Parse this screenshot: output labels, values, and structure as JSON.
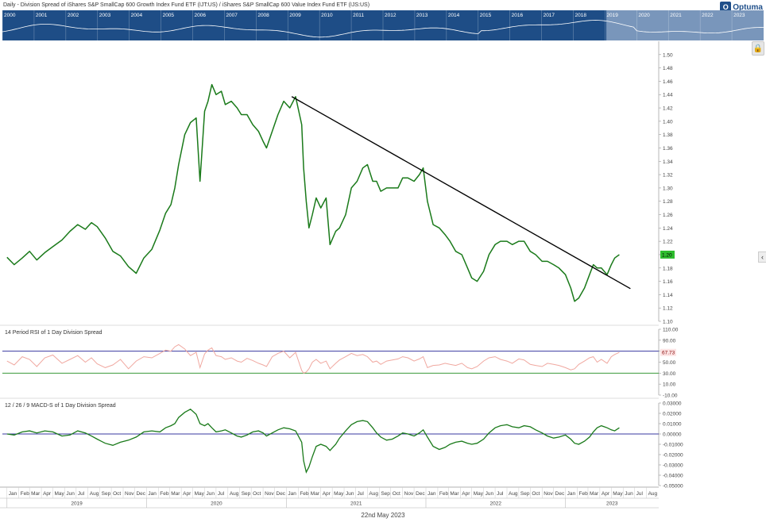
{
  "title": "Daily - Division Spread of iShares S&P SmallCap 600 Growth Index Fund ETF (IJT:US) / iShares S&P SmallCap 600 Value Index Fund ETF (IJS:US)",
  "logo_text": "Optuma",
  "date_caption": "22nd May 2023",
  "overview": {
    "years": [
      "2000",
      "2001",
      "2002",
      "2003",
      "2004",
      "2005",
      "2006",
      "2007",
      "2008",
      "2009",
      "2010",
      "2011",
      "2012",
      "2013",
      "2014",
      "2015",
      "2016",
      "2017",
      "2018",
      "2019",
      "2020",
      "2021",
      "2022",
      "2023"
    ]
  },
  "colors": {
    "price": "#1a7a1a",
    "trendline": "#000000",
    "rsi": "#f0a8a0",
    "rsi_upper": "#3a3aa0",
    "rsi_lower": "#3a9a3a",
    "macd": "#1a7a1a",
    "macd_zero": "#3a3aa0",
    "overview_bg": "#1e4d86",
    "badge_bg": "#2ebd2e"
  },
  "chart_data": [
    {
      "type": "line",
      "name": "price",
      "ylim": [
        1.1,
        1.52
      ],
      "y_ticks": [
        "1.50",
        "1.48",
        "1.46",
        "1.44",
        "1.42",
        "1.40",
        "1.38",
        "1.36",
        "1.34",
        "1.32",
        "1.30",
        "1.28",
        "1.26",
        "1.24",
        "1.22",
        "1.20",
        "1.18",
        "1.16",
        "1.14",
        "1.12",
        "1.10"
      ],
      "last_value_label": "1.20",
      "x": [
        "2019-01-01",
        "2019-01-20",
        "2019-02-10",
        "2019-03-01",
        "2019-03-20",
        "2019-04-10",
        "2019-05-01",
        "2019-05-25",
        "2019-06-15",
        "2019-07-05",
        "2019-07-25",
        "2019-08-10",
        "2019-08-25",
        "2019-09-15",
        "2019-10-05",
        "2019-10-25",
        "2019-11-15",
        "2019-12-05",
        "2019-12-25",
        "2020-01-15",
        "2020-02-05",
        "2020-02-20",
        "2020-03-05",
        "2020-03-15",
        "2020-03-25",
        "2020-04-10",
        "2020-04-25",
        "2020-05-10",
        "2020-05-20",
        "2020-06-01",
        "2020-06-10",
        "2020-06-20",
        "2020-07-01",
        "2020-07-15",
        "2020-07-25",
        "2020-08-10",
        "2020-08-25",
        "2020-09-05",
        "2020-09-20",
        "2020-10-05",
        "2020-10-20",
        "2020-11-01",
        "2020-11-10",
        "2020-11-25",
        "2020-12-10",
        "2020-12-25",
        "2021-01-10",
        "2021-01-25",
        "2021-02-10",
        "2021-02-15",
        "2021-02-22",
        "2021-03-01",
        "2021-03-10",
        "2021-03-20",
        "2021-04-01",
        "2021-04-15",
        "2021-04-25",
        "2021-05-10",
        "2021-05-20",
        "2021-06-05",
        "2021-06-20",
        "2021-07-05",
        "2021-07-20",
        "2021-08-01",
        "2021-08-15",
        "2021-08-25",
        "2021-09-05",
        "2021-09-20",
        "2021-10-05",
        "2021-10-20",
        "2021-11-01",
        "2021-11-15",
        "2021-12-01",
        "2021-12-15",
        "2021-12-25",
        "2022-01-05",
        "2022-01-20",
        "2022-02-05",
        "2022-02-20",
        "2022-03-05",
        "2022-03-20",
        "2022-04-05",
        "2022-04-20",
        "2022-05-01",
        "2022-05-15",
        "2022-06-01",
        "2022-06-15",
        "2022-07-01",
        "2022-07-15",
        "2022-08-01",
        "2022-08-15",
        "2022-09-01",
        "2022-09-15",
        "2022-10-01",
        "2022-10-15",
        "2022-11-01",
        "2022-11-15",
        "2022-12-01",
        "2022-12-15",
        "2023-01-01",
        "2023-01-15",
        "2023-01-25",
        "2023-02-05",
        "2023-02-20",
        "2023-03-05",
        "2023-03-15",
        "2023-03-25",
        "2023-04-05",
        "2023-04-20",
        "2023-05-01",
        "2023-05-10",
        "2023-05-22"
      ],
      "values": [
        1.196,
        1.185,
        1.195,
        1.205,
        1.192,
        1.203,
        1.212,
        1.222,
        1.235,
        1.245,
        1.238,
        1.248,
        1.242,
        1.225,
        1.205,
        1.198,
        1.182,
        1.172,
        1.195,
        1.208,
        1.237,
        1.262,
        1.275,
        1.3,
        1.335,
        1.38,
        1.398,
        1.405,
        1.31,
        1.415,
        1.43,
        1.455,
        1.44,
        1.445,
        1.425,
        1.43,
        1.42,
        1.41,
        1.41,
        1.395,
        1.385,
        1.37,
        1.36,
        1.385,
        1.41,
        1.43,
        1.42,
        1.437,
        1.395,
        1.33,
        1.28,
        1.24,
        1.26,
        1.285,
        1.27,
        1.285,
        1.215,
        1.235,
        1.24,
        1.26,
        1.3,
        1.31,
        1.33,
        1.335,
        1.31,
        1.31,
        1.295,
        1.3,
        1.3,
        1.3,
        1.315,
        1.315,
        1.31,
        1.32,
        1.33,
        1.28,
        1.245,
        1.24,
        1.23,
        1.22,
        1.205,
        1.2,
        1.18,
        1.165,
        1.16,
        1.175,
        1.2,
        1.215,
        1.22,
        1.22,
        1.215,
        1.22,
        1.22,
        1.205,
        1.2,
        1.19,
        1.19,
        1.185,
        1.18,
        1.17,
        1.15,
        1.13,
        1.135,
        1.15,
        1.17,
        1.185,
        1.18,
        1.18,
        1.17,
        1.185,
        1.195,
        1.2
      ],
      "trendline": {
        "x": [
          "2021-01-15",
          "2023-06-20"
        ],
        "values": [
          1.437,
          1.149
        ]
      }
    },
    {
      "type": "line",
      "name": "rsi",
      "label": "14 Period RSI of 1 Day Division Spread",
      "ylim": [
        -10,
        110
      ],
      "y_ticks": [
        "110.00",
        "90.00",
        "70.00",
        "50.00",
        "30.00",
        "10.00",
        "-10.00"
      ],
      "upper_level": 70,
      "lower_level": 30,
      "last_value_label": "67.73",
      "values": [
        52,
        45,
        60,
        55,
        42,
        58,
        63,
        48,
        55,
        62,
        50,
        58,
        47,
        40,
        45,
        55,
        38,
        52,
        60,
        58,
        66,
        72,
        70,
        78,
        82,
        74,
        62,
        68,
        40,
        65,
        72,
        76,
        62,
        60,
        55,
        58,
        52,
        50,
        57,
        53,
        48,
        45,
        42,
        60,
        66,
        70,
        58,
        68,
        35,
        30,
        32,
        38,
        50,
        55,
        48,
        52,
        38,
        48,
        54,
        60,
        66,
        62,
        64,
        60,
        50,
        52,
        46,
        52,
        54,
        56,
        60,
        58,
        52,
        56,
        60,
        40,
        44,
        45,
        48,
        46,
        44,
        48,
        40,
        38,
        42,
        52,
        58,
        60,
        55,
        52,
        48,
        56,
        54,
        46,
        44,
        42,
        48,
        46,
        44,
        40,
        36,
        38,
        46,
        52,
        58,
        60,
        50,
        55,
        48,
        60,
        64,
        67.73
      ]
    },
    {
      "type": "line",
      "name": "macd",
      "label": "12 / 26 / 9 MACD-S of 1 Day Division Spread",
      "ylim": [
        -0.05,
        0.03
      ],
      "y_ticks": [
        "0.03000",
        "0.02000",
        "0.01000",
        "0.00000",
        "-0.01000",
        "-0.02000",
        "-0.03000",
        "-0.04000",
        "-0.05000"
      ],
      "zero_line": 0,
      "values": [
        0.0,
        -0.001,
        0.002,
        0.003,
        0.001,
        0.003,
        0.002,
        -0.002,
        -0.001,
        0.003,
        0.001,
        -0.002,
        -0.005,
        -0.009,
        -0.011,
        -0.008,
        -0.006,
        -0.003,
        0.002,
        0.003,
        0.002,
        0.006,
        0.008,
        0.01,
        0.016,
        0.021,
        0.024,
        0.019,
        0.01,
        0.008,
        0.01,
        0.006,
        0.002,
        0.003,
        0.004,
        0.001,
        -0.002,
        -0.003,
        -0.001,
        0.002,
        0.003,
        0.001,
        -0.002,
        0.001,
        0.004,
        0.006,
        0.005,
        0.003,
        -0.008,
        -0.026,
        -0.037,
        -0.032,
        -0.022,
        -0.012,
        -0.01,
        -0.012,
        -0.016,
        -0.01,
        -0.004,
        0.003,
        0.009,
        0.012,
        0.013,
        0.012,
        0.006,
        0.001,
        -0.003,
        -0.006,
        -0.005,
        -0.002,
        0.001,
        0.0,
        -0.002,
        0.001,
        0.004,
        -0.003,
        -0.012,
        -0.015,
        -0.013,
        -0.01,
        -0.008,
        -0.007,
        -0.009,
        -0.01,
        -0.009,
        -0.005,
        0.001,
        0.006,
        0.008,
        0.009,
        0.007,
        0.006,
        0.008,
        0.007,
        0.004,
        0.001,
        -0.002,
        -0.004,
        -0.003,
        -0.001,
        -0.005,
        -0.009,
        -0.01,
        -0.007,
        -0.003,
        0.002,
        0.006,
        0.008,
        0.006,
        0.004,
        0.003,
        0.006
      ]
    }
  ],
  "x_axis": {
    "month_labels": [
      {
        "date": "2019-01-01",
        "label": "Jan"
      },
      {
        "date": "2019-02-01",
        "label": "Feb"
      },
      {
        "date": "2019-03-01",
        "label": "Mar"
      },
      {
        "date": "2019-04-01",
        "label": "Apr"
      },
      {
        "date": "2019-05-01",
        "label": "May"
      },
      {
        "date": "2019-06-01",
        "label": "Jun"
      },
      {
        "date": "2019-07-01",
        "label": "Jul"
      },
      {
        "date": "2019-08-01",
        "label": "Aug"
      },
      {
        "date": "2019-09-01",
        "label": "Sep"
      },
      {
        "date": "2019-10-01",
        "label": "Oct"
      },
      {
        "date": "2019-11-01",
        "label": "Nov"
      },
      {
        "date": "2019-12-01",
        "label": "Dec"
      },
      {
        "date": "2020-01-01",
        "label": "Jan"
      },
      {
        "date": "2020-02-01",
        "label": "Feb"
      },
      {
        "date": "2020-03-01",
        "label": "Mar"
      },
      {
        "date": "2020-04-01",
        "label": "Apr"
      },
      {
        "date": "2020-05-01",
        "label": "May"
      },
      {
        "date": "2020-06-01",
        "label": "Jun"
      },
      {
        "date": "2020-07-01",
        "label": "Jul"
      },
      {
        "date": "2020-08-01",
        "label": "Aug"
      },
      {
        "date": "2020-09-01",
        "label": "Sep"
      },
      {
        "date": "2020-10-01",
        "label": "Oct"
      },
      {
        "date": "2020-11-01",
        "label": "Nov"
      },
      {
        "date": "2020-12-01",
        "label": "Dec"
      },
      {
        "date": "2021-01-01",
        "label": "Jan"
      },
      {
        "date": "2021-02-01",
        "label": "Feb"
      },
      {
        "date": "2021-03-01",
        "label": "Mar"
      },
      {
        "date": "2021-04-01",
        "label": "Apr"
      },
      {
        "date": "2021-05-01",
        "label": "May"
      },
      {
        "date": "2021-06-01",
        "label": "Jun"
      },
      {
        "date": "2021-07-01",
        "label": "Jul"
      },
      {
        "date": "2021-08-01",
        "label": "Aug"
      },
      {
        "date": "2021-09-01",
        "label": "Sep"
      },
      {
        "date": "2021-10-01",
        "label": "Oct"
      },
      {
        "date": "2021-11-01",
        "label": "Nov"
      },
      {
        "date": "2021-12-01",
        "label": "Dec"
      },
      {
        "date": "2022-01-01",
        "label": "Jan"
      },
      {
        "date": "2022-02-01",
        "label": "Feb"
      },
      {
        "date": "2022-03-01",
        "label": "Mar"
      },
      {
        "date": "2022-04-01",
        "label": "Apr"
      },
      {
        "date": "2022-05-01",
        "label": "May"
      },
      {
        "date": "2022-06-01",
        "label": "Jun"
      },
      {
        "date": "2022-07-01",
        "label": "Jul"
      },
      {
        "date": "2022-08-01",
        "label": "Aug"
      },
      {
        "date": "2022-09-01",
        "label": "Sep"
      },
      {
        "date": "2022-10-01",
        "label": "Oct"
      },
      {
        "date": "2022-11-01",
        "label": "Nov"
      },
      {
        "date": "2022-12-01",
        "label": "Dec"
      },
      {
        "date": "2023-01-01",
        "label": "Jan"
      },
      {
        "date": "2023-02-01",
        "label": "Feb"
      },
      {
        "date": "2023-03-01",
        "label": "Mar"
      },
      {
        "date": "2023-04-01",
        "label": "Apr"
      },
      {
        "date": "2023-05-01",
        "label": "May"
      },
      {
        "date": "2023-06-01",
        "label": "Jun"
      },
      {
        "date": "2023-07-01",
        "label": "Jul"
      },
      {
        "date": "2023-08-01",
        "label": "Aug"
      }
    ],
    "year_labels": [
      {
        "start": "2019-01-01",
        "end": "2020-01-01",
        "label": "2019"
      },
      {
        "start": "2020-01-01",
        "end": "2021-01-01",
        "label": "2020"
      },
      {
        "start": "2021-01-01",
        "end": "2022-01-01",
        "label": "2021"
      },
      {
        "start": "2022-01-01",
        "end": "2023-01-01",
        "label": "2022"
      },
      {
        "start": "2023-01-01",
        "end": "2024-01-01",
        "label": "2023"
      }
    ]
  }
}
